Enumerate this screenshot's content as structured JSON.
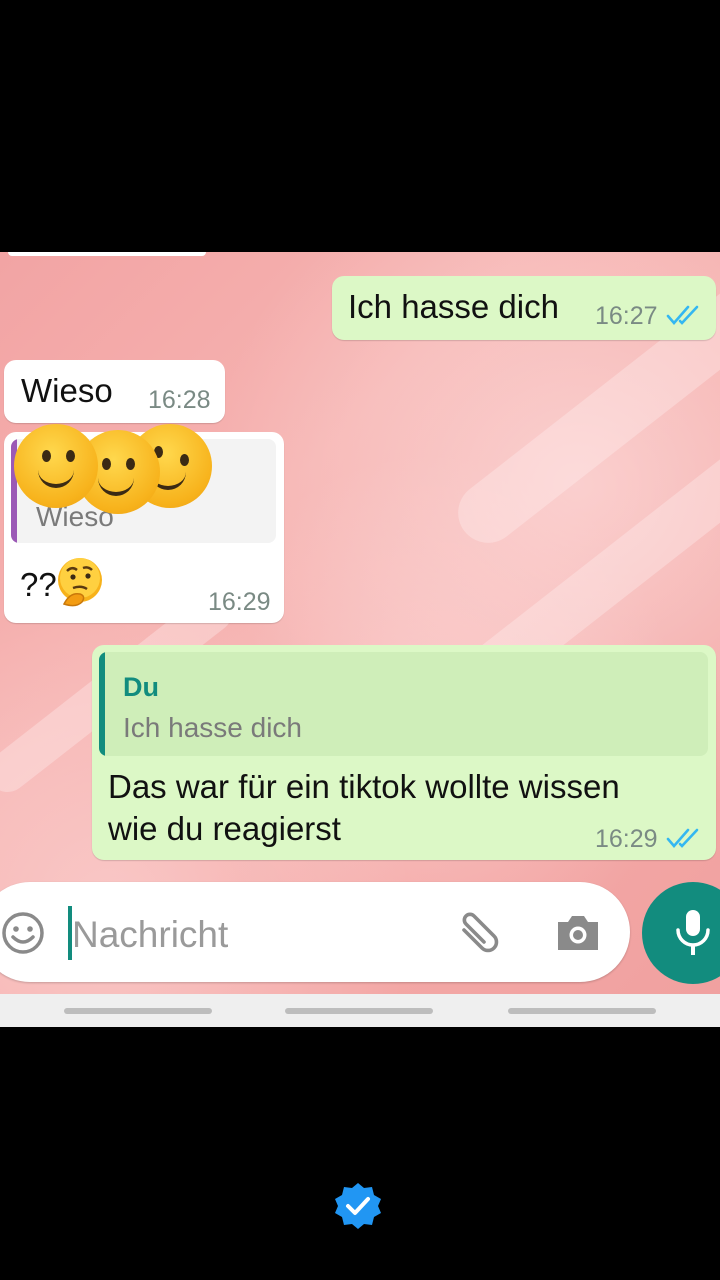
{
  "messages": [
    {
      "id": "m1",
      "side": "out",
      "text": "Ich hasse dich",
      "time": "16:27",
      "ticks": "read"
    },
    {
      "id": "m2",
      "side": "in",
      "text": "Wieso",
      "time": "16:28"
    },
    {
      "id": "m3",
      "side": "in",
      "quote_text": "Wieso",
      "text": "??",
      "time": "16:29"
    },
    {
      "id": "m4",
      "side": "out",
      "quote_name": "Du",
      "quote_text": "Ich hasse dich",
      "text_line1": "Das war für ein tiktok wollte wissen",
      "text_line2": "wie du reagierst",
      "time": "16:29",
      "ticks": "read"
    }
  ],
  "input": {
    "placeholder": "Nachricht"
  },
  "icons": {
    "emoji": "emoji-smile-icon",
    "attach": "paperclip-icon",
    "camera": "camera-icon",
    "mic": "microphone-icon",
    "thinking": "thinking-face-emoji",
    "overlay": "smiley-faces-overlay",
    "verified": "verified-badge-icon"
  },
  "colors": {
    "outgoing_bubble": "#dcf8c6",
    "incoming_bubble": "#ffffff",
    "accent": "#128c7e",
    "read_ticks": "#34b7f1",
    "incoming_quote_bar": "#9b59b6",
    "outgoing_quote_bar": "#128c7e",
    "verified": "#2196f3"
  }
}
